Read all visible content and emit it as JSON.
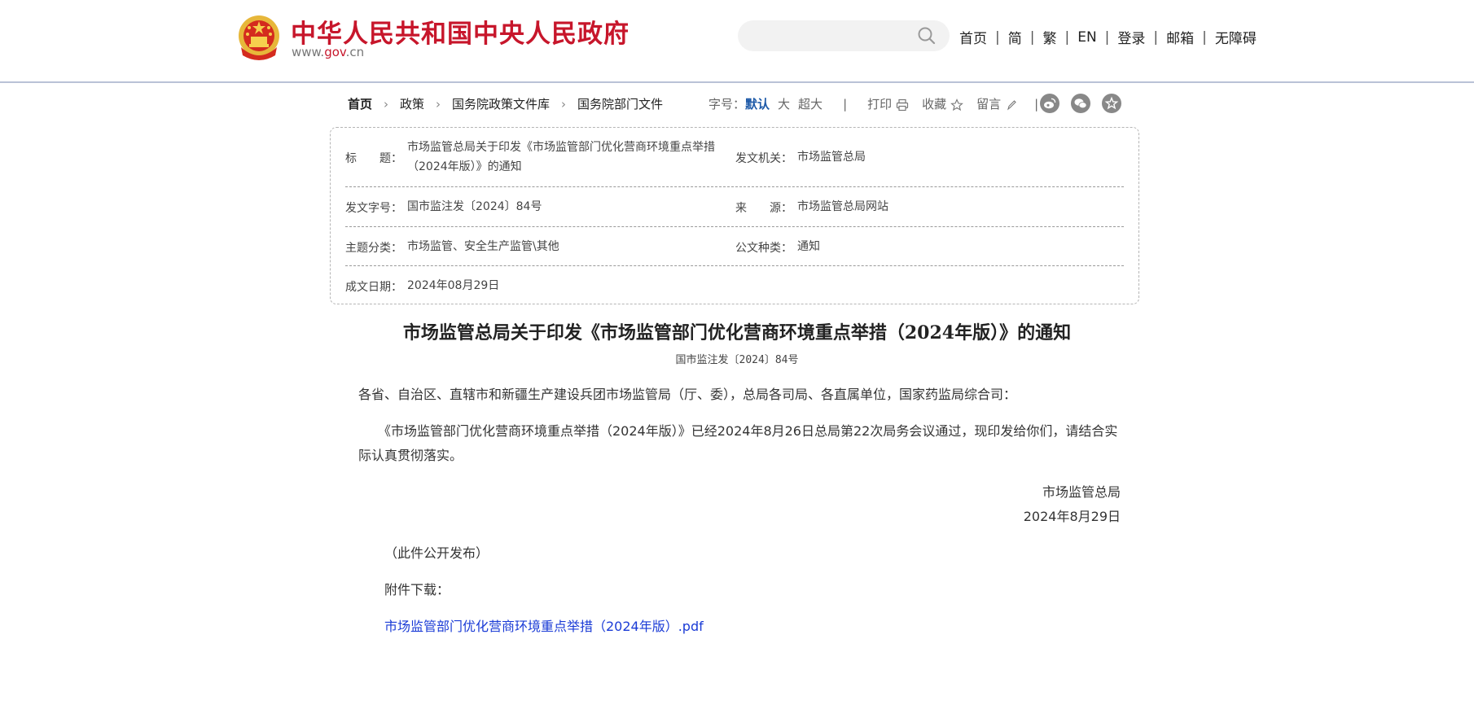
{
  "header": {
    "site_title": "中华人民共和国中央人民政府",
    "site_url_prefix": "www.",
    "site_url_domain": "gov",
    "site_url_suffix": ".cn",
    "search_placeholder": "",
    "nav": [
      "首页",
      "简",
      "繁",
      "EN",
      "登录",
      "邮箱",
      "无障碍"
    ]
  },
  "breadcrumb": [
    "首页",
    "政策",
    "国务院政策文件库",
    "国务院部门文件"
  ],
  "tools": {
    "font_label": "字号：",
    "font_default": "默认",
    "font_large": "大",
    "font_xlarge": "超大",
    "print": "打印",
    "favorite": "收藏",
    "comment": "留言"
  },
  "share_icons": [
    "weibo-icon",
    "wechat-icon",
    "favorite-star-icon"
  ],
  "meta": {
    "title_label": "标　　题：",
    "title_value": "市场监管总局关于印发《市场监管部门优化营商环境重点举措（2024年版）》的通知",
    "issuer_label": "发文机关：",
    "issuer_value": "市场监管总局",
    "doc_no_label": "发文字号：",
    "doc_no_value": "国市监注发〔2024〕84号",
    "source_label": "来　　源：",
    "source_value": "市场监管总局网站",
    "topic_label": "主题分类：",
    "topic_value": "市场监管、安全生产监管\\其他",
    "type_label": "公文种类：",
    "type_value": "通知",
    "date_label": "成文日期：",
    "date_value": "2024年08月29日"
  },
  "document": {
    "title": "市场监管总局关于印发《市场监管部门优化营商环境重点举措（2024年版）》的通知",
    "number": "国市监注发〔2024〕84号",
    "salutation": "各省、自治区、直辖市和新疆生产建设兵团市场监管局（厅、委），总局各司局、各直属单位，国家药监局综合司：",
    "body": "　　《市场监管部门优化营商环境重点举措（2024年版）》已经2024年8月26日总局第22次局务会议通过，现印发给你们，请结合实际认真贯彻落实。",
    "signature": "市场监管总局",
    "sign_date": "2024年8月29日",
    "public_note": "（此件公开发布）",
    "attachment_label": "附件下载：",
    "attachment_link": "市场监管部门优化营商环境重点举措（2024年版）.pdf"
  }
}
